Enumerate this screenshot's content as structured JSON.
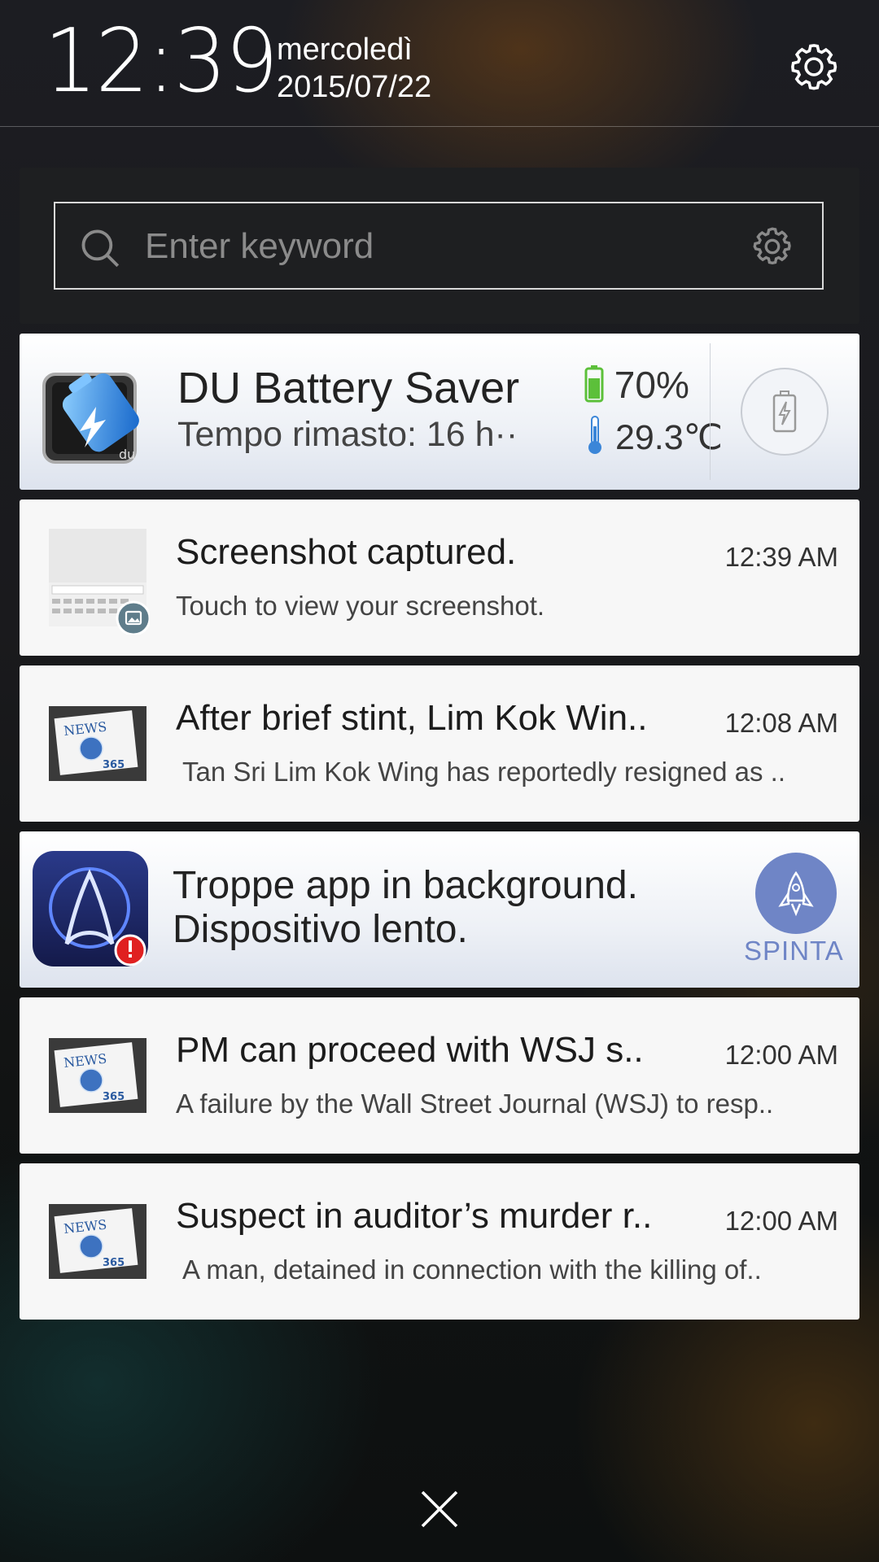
{
  "header": {
    "time": "12:39",
    "weekday": "mercoledì",
    "date": "2015/07/22"
  },
  "search": {
    "placeholder": "Enter keyword"
  },
  "notifications": [
    {
      "app": "DU Battery Saver",
      "title": "DU Battery Saver",
      "subtitle": "Tempo rimasto: 16 h··",
      "battery_percent": "70%",
      "temperature": "29.3℃"
    },
    {
      "title": "Screenshot captured.",
      "subtitle": "Touch to view your screenshot.",
      "time": "12:39 AM"
    },
    {
      "title": "After brief stint, Lim Kok Win..",
      "subtitle": "Tan Sri Lim Kok Wing has reportedly resigned as ..",
      "time": "12:08 AM"
    },
    {
      "title_line1": "Troppe app in background.",
      "title_line2": "Dispositivo lento.",
      "action_label": "SPINTA"
    },
    {
      "title": "PM can proceed with WSJ s..",
      "subtitle": "A failure by the Wall Street Journal (WSJ) to resp..",
      "time": "12:00 AM"
    },
    {
      "title": "Suspect in auditor’s murder r..",
      "subtitle": "A man, detained in connection with the killing of..",
      "time": "12:00 AM"
    }
  ],
  "icons": {
    "settings": "gear-icon",
    "search": "search-icon",
    "close": "close-icon",
    "news_app": "news-365-icon",
    "battery_app": "du-battery-icon",
    "booster_app": "booster-icon"
  },
  "colors": {
    "accent_blue": "#6f85c6",
    "battery_green": "#5cc03a",
    "alert_red": "#e02020"
  }
}
